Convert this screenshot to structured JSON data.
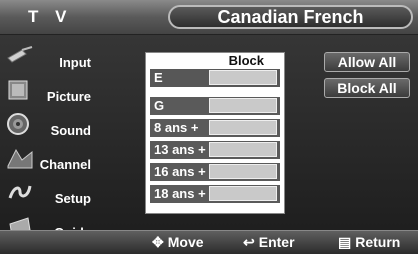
{
  "header": {
    "tv_label": "T V",
    "title": "Canadian French"
  },
  "sidebar": {
    "items": [
      {
        "label": "Input",
        "icon": "input-icon"
      },
      {
        "label": "Picture",
        "icon": "picture-icon"
      },
      {
        "label": "Sound",
        "icon": "sound-icon"
      },
      {
        "label": "Channel",
        "icon": "channel-icon"
      },
      {
        "label": "Setup",
        "icon": "setup-icon"
      },
      {
        "label": "Guide",
        "icon": "guide-icon"
      }
    ]
  },
  "panel": {
    "column_header": "Block",
    "ratings": [
      {
        "label": "E"
      },
      {
        "label": "G"
      },
      {
        "label": "8 ans +"
      },
      {
        "label": "13 ans +"
      },
      {
        "label": "16 ans +"
      },
      {
        "label": "18 ans +"
      }
    ]
  },
  "actions": {
    "allow_all": "Allow All",
    "block_all": "Block All"
  },
  "footer": {
    "move": "Move",
    "enter": "Enter",
    "return": "Return"
  }
}
